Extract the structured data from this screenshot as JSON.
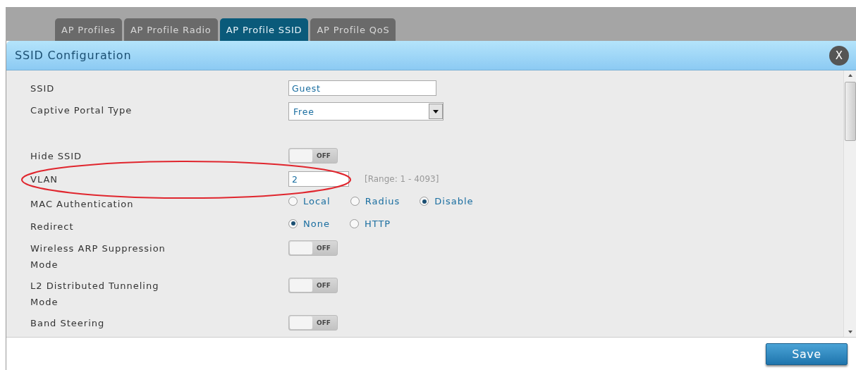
{
  "tabs": [
    {
      "label": "AP Profiles",
      "selected": false
    },
    {
      "label": "AP Profile Radio",
      "selected": false
    },
    {
      "label": "AP Profile SSID",
      "selected": true
    },
    {
      "label": "AP Profile QoS",
      "selected": false
    }
  ],
  "dialog": {
    "title": "SSID Configuration",
    "close": "X",
    "save": "Save"
  },
  "fields": [
    {
      "kind": "text",
      "label": "SSID",
      "value": "Guest"
    },
    {
      "kind": "select",
      "label": "Captive Portal Type",
      "value": "Free"
    },
    {
      "kind": "spacer"
    },
    {
      "kind": "toggle",
      "label": "Hide SSID",
      "on": false,
      "off_text": "OFF"
    },
    {
      "kind": "range",
      "label": "VLAN",
      "value": "2",
      "hint": "[Range: 1 - 4093]",
      "highlighted": true
    },
    {
      "kind": "radio",
      "label": "MAC Authentication",
      "options": [
        {
          "label": "Local",
          "selected": false
        },
        {
          "label": "Radius",
          "selected": false
        },
        {
          "label": "Disable",
          "selected": true
        }
      ]
    },
    {
      "kind": "radio",
      "label": "Redirect",
      "options": [
        {
          "label": "None",
          "selected": true
        },
        {
          "label": "HTTP",
          "selected": false
        }
      ]
    },
    {
      "kind": "toggle",
      "label": "Wireless ARP Suppression Mode",
      "on": false,
      "off_text": "OFF"
    },
    {
      "kind": "toggle",
      "label": "L2 Distributed Tunneling Mode",
      "on": false,
      "off_text": "OFF"
    },
    {
      "kind": "toggle",
      "label": "Band Steering",
      "on": false,
      "off_text": "OFF"
    }
  ]
}
